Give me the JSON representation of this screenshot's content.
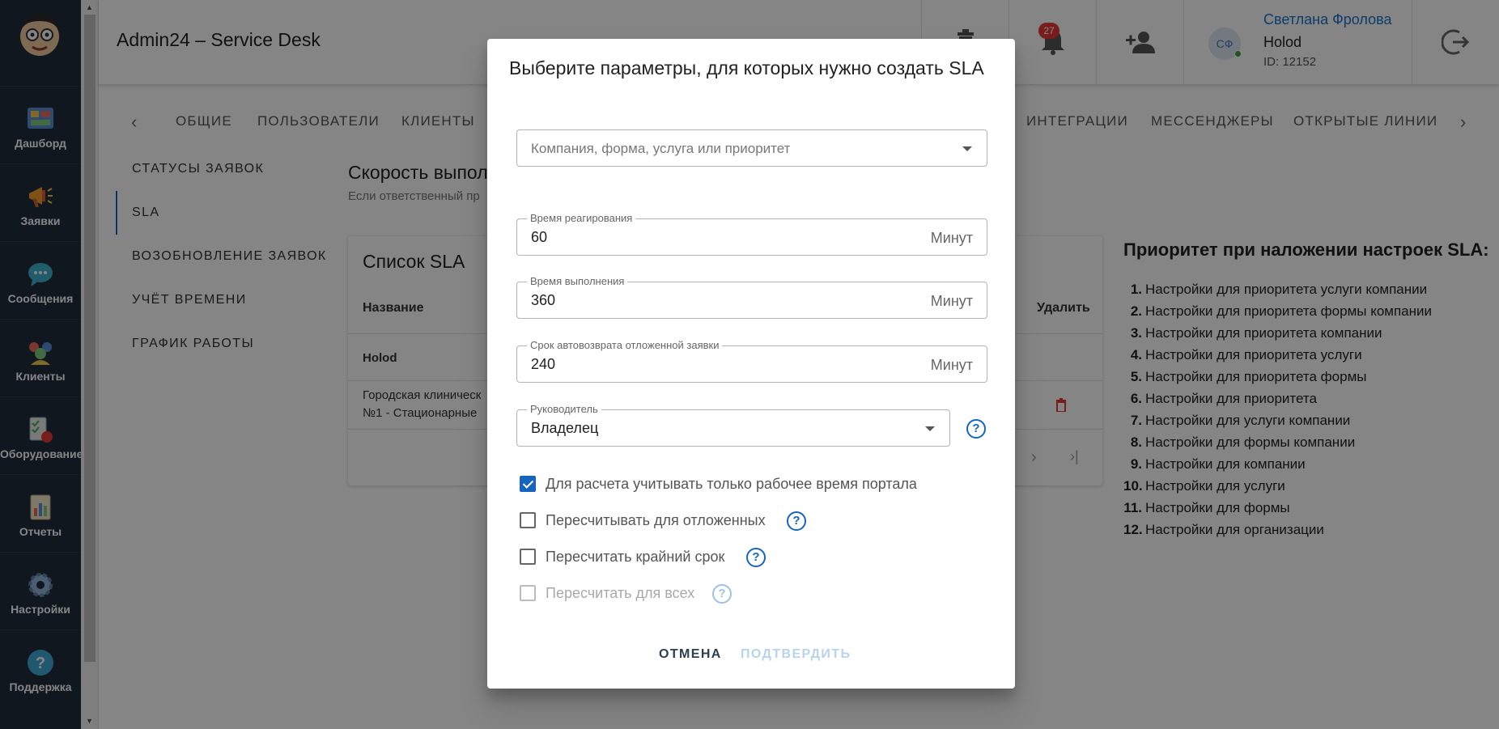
{
  "app": {
    "title": "Admin24 – Service Desk"
  },
  "sidebar": {
    "items": [
      {
        "label": "Дашборд",
        "icon": "dashboard-icon"
      },
      {
        "label": "Заявки",
        "icon": "megaphone-icon"
      },
      {
        "label": "Сообщения",
        "icon": "chat-icon"
      },
      {
        "label": "Клиенты",
        "icon": "clients-icon"
      },
      {
        "label": "Оборудование",
        "icon": "equipment-icon"
      },
      {
        "label": "Отчеты",
        "icon": "reports-icon"
      },
      {
        "label": "Настройки",
        "icon": "gear-icon"
      },
      {
        "label": "Поддержка",
        "icon": "support-icon"
      }
    ]
  },
  "header": {
    "notifications_count": "27",
    "user": {
      "initials": "СФ",
      "name": "Светлана Фролова",
      "org": "Holod",
      "id": "ID: 12152"
    }
  },
  "tabs": [
    "ОБЩИЕ",
    "ПОЛЬЗОВАТЕЛИ",
    "КЛИЕНТЫ",
    "ИНТЕГРАЦИИ",
    "МЕССЕНДЖЕРЫ",
    "ОТКРЫТЫЕ ЛИНИИ"
  ],
  "settings_menu": [
    "СТАТУСЫ ЗАЯВОК",
    "SLA",
    "ВОЗОБНОВЛЕНИЕ ЗАЯВОК",
    "УЧЁТ ВРЕМЕНИ",
    "ГРАФИК РАБОТЫ"
  ],
  "content": {
    "title": "Скорость выпол",
    "subtitle": "Если ответственный пр",
    "card": {
      "title": "Список SLA",
      "col_name": "Название",
      "col_delete": "Удалить",
      "group": "Holod",
      "row_line1": "Городская клиническ",
      "row_line2": "№1 - Стационарные"
    }
  },
  "priority": {
    "title": "Приоритет при наложении настроек SLA:",
    "items": [
      "Настройки для приоритета услуги компании",
      "Настройки для приоритета формы компании",
      "Настройки для приоритета компании",
      "Настройки для приоритета услуги",
      "Настройки для приоритета формы",
      "Настройки для приоритета",
      "Настройки для услуги компании",
      "Настройки для формы компании",
      "Настройки для компании",
      "Настройки для услуги",
      "Настройки для формы",
      "Настройки для организации"
    ]
  },
  "dialog": {
    "title": "Выберите параметры, для которых нужно создать SLA",
    "select_placeholder": "Компания, форма, услуга или приоритет",
    "reaction": {
      "label": "Время реагирования",
      "value": "60",
      "suffix": "Минут"
    },
    "execution": {
      "label": "Время выполнения",
      "value": "360",
      "suffix": "Минут"
    },
    "autoreturn": {
      "label": "Срок автовозврата отложенной заявки",
      "value": "240",
      "suffix": "Минут"
    },
    "manager": {
      "label": "Руководитель",
      "value": "Владелец"
    },
    "checkboxes": [
      {
        "label": "Для расчета учитывать только рабочее время портала",
        "checked": true,
        "disabled": false
      },
      {
        "label": "Пересчитывать для отложенных",
        "checked": false,
        "disabled": false
      },
      {
        "label": "Пересчитать крайний срок",
        "checked": false,
        "disabled": false
      },
      {
        "label": "Пересчитать для всех",
        "checked": false,
        "disabled": true
      }
    ],
    "cancel_label": "ОТМЕНА",
    "confirm_label": "ПОДТВЕРДИТЬ",
    "help_glyph": "?"
  },
  "colors": {
    "accent": "#1565c0",
    "badge": "#e53935",
    "sidebar": "#1f2d3d"
  }
}
